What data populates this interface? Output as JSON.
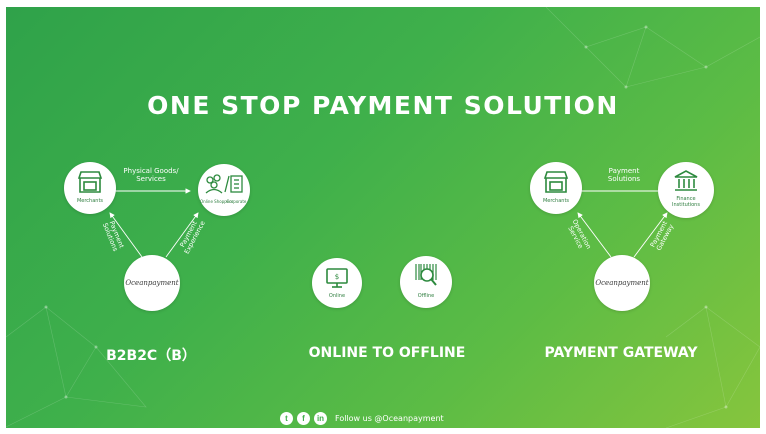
{
  "title": "ONE STOP PAYMENT SOLUTION",
  "sections": {
    "b2b2c": {
      "heading": "B2B2C（B）",
      "merchants_label": "Merchants",
      "buyers_label": "Online Shoppers",
      "corporate_label": "Corporate",
      "logo": "Oceanpayment",
      "flow_top": [
        "Physical Goods/",
        "Services"
      ],
      "flow_left": [
        "Payment",
        "Solutions"
      ],
      "flow_right": [
        "Payment",
        "Experience"
      ]
    },
    "o2o": {
      "heading": "ONLINE TO OFFLINE",
      "online_label": "Online",
      "offline_label": "Offline",
      "screen_text": "$"
    },
    "gateway": {
      "heading": "PAYMENT GATEWAY",
      "merchants_label": "Merchants",
      "finance_label": [
        "Finance",
        "Institutions"
      ],
      "logo": "Oceanpayment",
      "flow_top": [
        "Payment",
        "Solutions"
      ],
      "flow_left": [
        "Operation",
        "Service"
      ],
      "flow_right": [
        "Payment",
        "Gateway"
      ]
    }
  },
  "footer": {
    "icons": [
      "twitter-icon",
      "facebook-icon",
      "linkedin-icon"
    ],
    "text": "Follow us @Oceanpayment"
  },
  "colors": {
    "bg_start": "#2fa24a",
    "bg_end": "#86c53d",
    "icon_green": "#2d8a3e",
    "text": "#ffffff"
  }
}
